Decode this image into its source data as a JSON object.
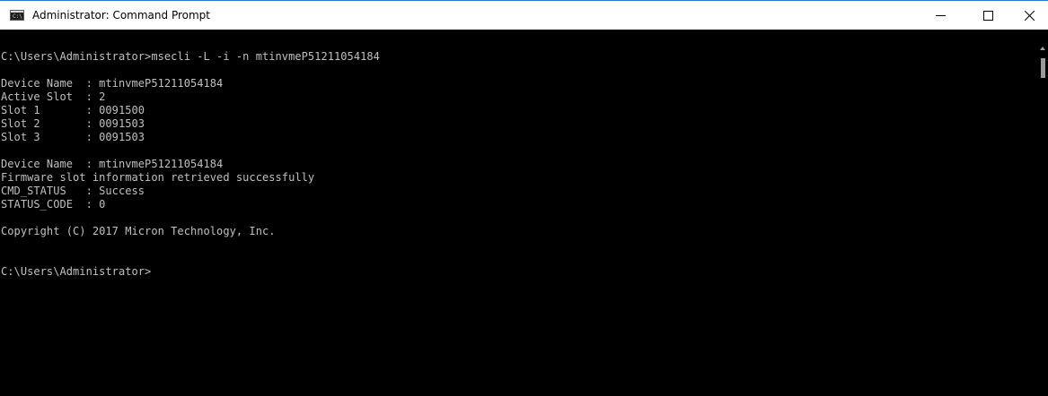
{
  "window": {
    "title": "Administrator: Command Prompt",
    "icon": "cmd-icon",
    "icon_prompt": "C:\\",
    "controls": {
      "minimize": "minimize-icon",
      "maximize": "maximize-icon",
      "close": "close-icon"
    },
    "colors": {
      "titlebar_bg": "#ffffff",
      "console_bg": "#000000",
      "console_fg": "#c0c0c0",
      "border_accent": "#2b79d7"
    }
  },
  "console": {
    "lines": [
      "C:\\Users\\Administrator>msecli -L -i -n mtinvmeP51211054184",
      "",
      "Device Name  : mtinvmeP51211054184",
      "Active Slot  : 2",
      "Slot 1       : 0091500",
      "Slot 2       : 0091503",
      "Slot 3       : 0091503",
      "",
      "Device Name  : mtinvmeP51211054184",
      "Firmware slot information retrieved successfully",
      "CMD_STATUS   : Success",
      "STATUS_CODE  : 0",
      "",
      "Copyright (C) 2017 Micron Technology, Inc.",
      "",
      "",
      "C:\\Users\\Administrator>"
    ]
  },
  "scrollbar": {
    "up_arrow": "scroll-up-arrow-icon"
  }
}
